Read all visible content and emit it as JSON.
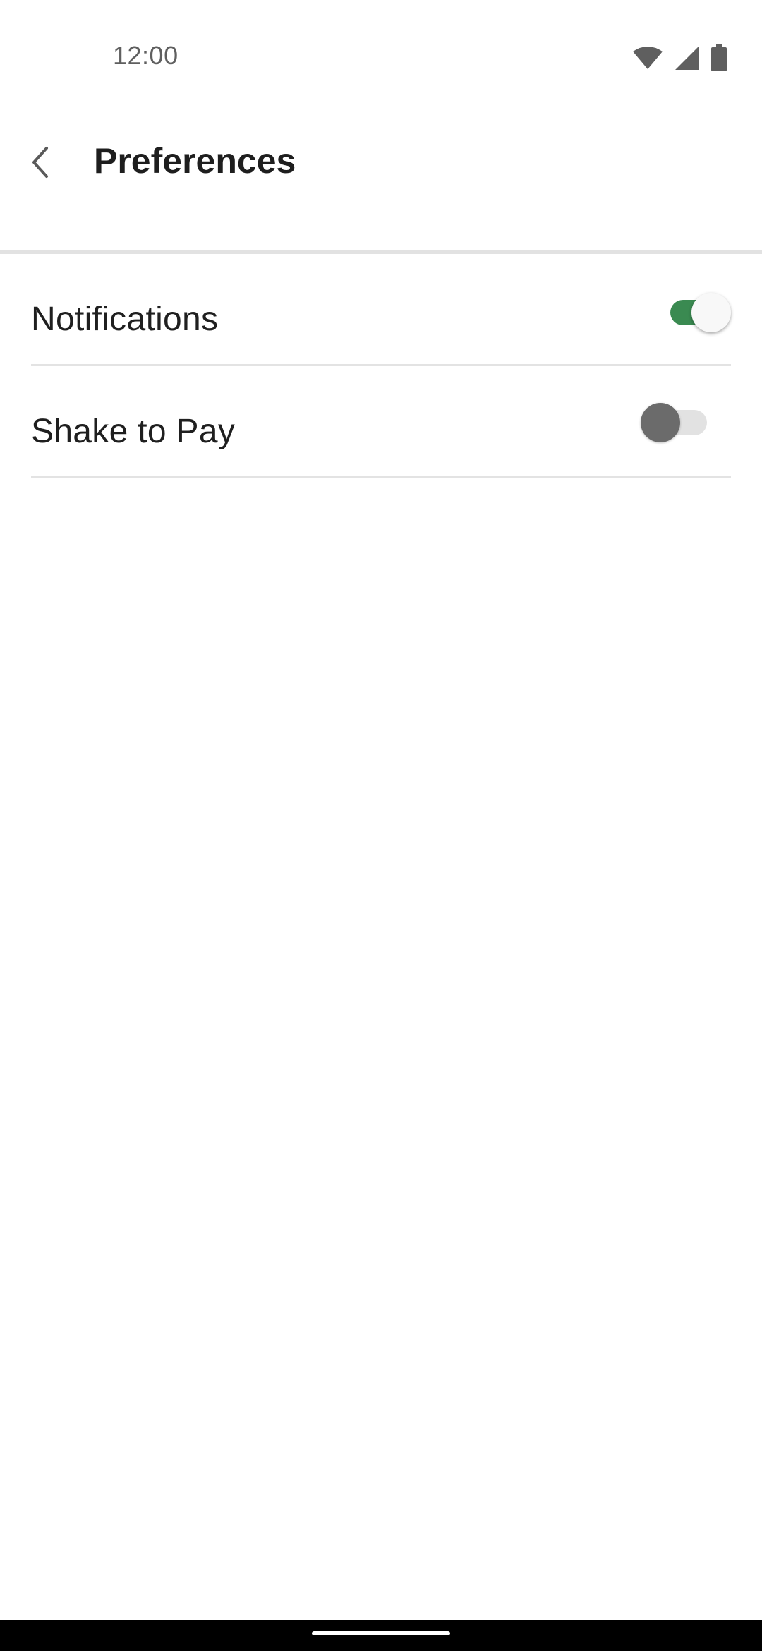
{
  "status_bar": {
    "time": "12:00",
    "icons": [
      "wifi-icon",
      "signal-icon",
      "battery-icon"
    ]
  },
  "app_bar": {
    "back_icon": "chevron-left-icon",
    "title": "Preferences"
  },
  "settings": [
    {
      "label": "Notifications",
      "enabled": true
    },
    {
      "label": "Shake to Pay",
      "enabled": false
    }
  ],
  "colors": {
    "toggle_on_track": "#3a8a51",
    "toggle_off_track": "#e2e2e2",
    "toggle_off_thumb": "#6b6b6b",
    "divider": "#e3e3e3"
  }
}
